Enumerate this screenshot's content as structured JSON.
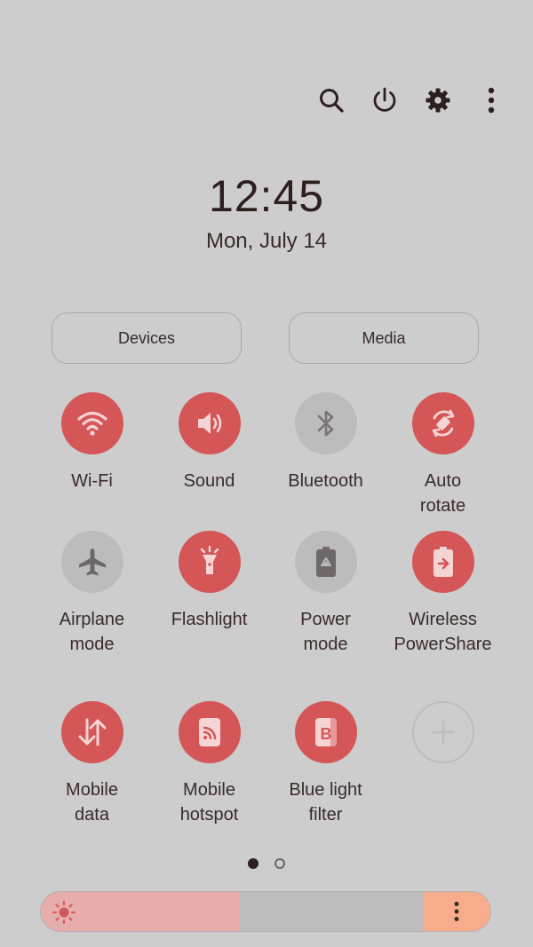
{
  "header": {
    "icons": [
      "search-icon",
      "power-icon",
      "gear-icon",
      "more-vertical-icon"
    ]
  },
  "clock": {
    "time": "12:45",
    "date": "Mon, July 14"
  },
  "buttons": {
    "devices": "Devices",
    "media": "Media"
  },
  "tiles": [
    {
      "label": "Wi-Fi",
      "icon": "wifi-icon",
      "state": "on"
    },
    {
      "label": "Sound",
      "icon": "speaker-icon",
      "state": "on"
    },
    {
      "label": "Bluetooth",
      "icon": "bluetooth-icon",
      "state": "off"
    },
    {
      "label": "Auto\nrotate",
      "icon": "rotate-icon",
      "state": "on"
    },
    {
      "label": "Airplane\nmode",
      "icon": "airplane-icon",
      "state": "off"
    },
    {
      "label": "Flashlight",
      "icon": "flashlight-icon",
      "state": "on"
    },
    {
      "label": "Power\nmode",
      "icon": "battery-recycle-icon",
      "state": "off"
    },
    {
      "label": "Wireless\nPowerShare",
      "icon": "power-share-icon",
      "state": "on"
    },
    {
      "label": "Mobile\ndata",
      "icon": "data-arrows-icon",
      "state": "on"
    },
    {
      "label": "Mobile\nhotspot",
      "icon": "hotspot-icon",
      "state": "on"
    },
    {
      "label": "Blue light\nfilter",
      "icon": "blue-light-icon",
      "state": "on"
    },
    {
      "label": "",
      "icon": "plus-icon",
      "state": "add"
    }
  ],
  "pager": {
    "current": 1,
    "total": 2
  },
  "brightness": {
    "level": 0.44
  },
  "colors": {
    "background": "#cdcdcd",
    "accent_on": "#d45656",
    "tile_off": "#bcbcbc",
    "brightness_fill": "#e7adad",
    "brightness_more": "#f7ad8c"
  }
}
